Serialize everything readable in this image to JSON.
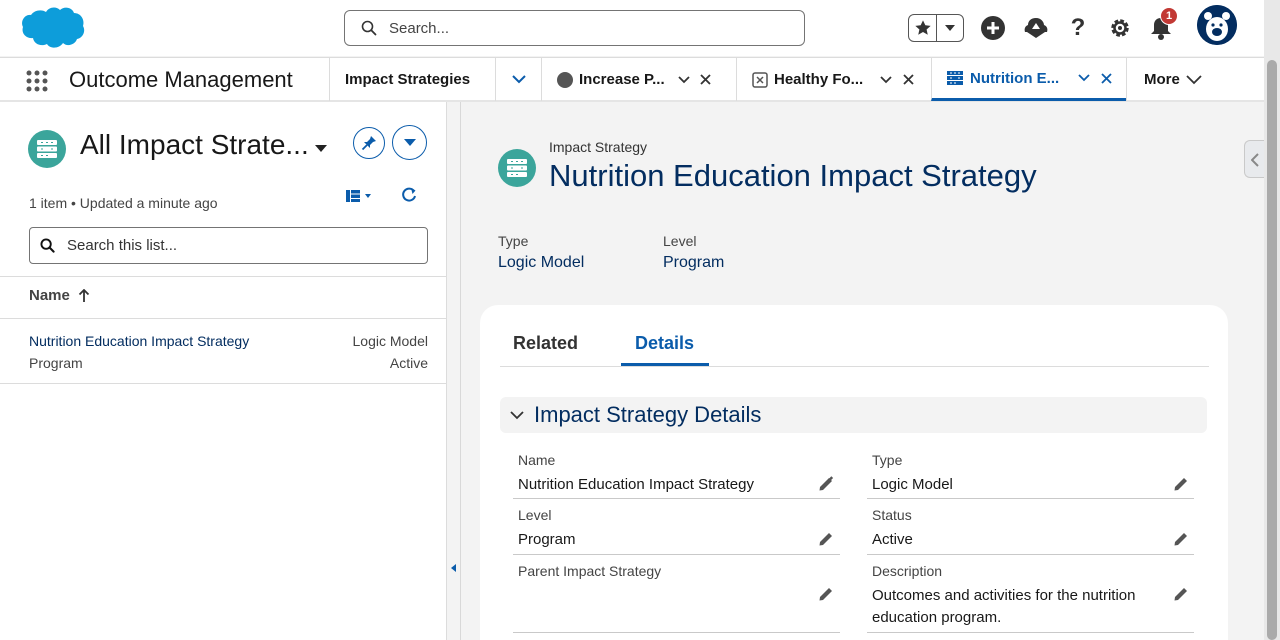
{
  "header": {
    "search_placeholder": "Search...",
    "notification_count": "1"
  },
  "nav": {
    "app_name": "Outcome Management",
    "tabs": [
      {
        "label": "Impact Strategies"
      },
      {
        "label": "Increase P..."
      },
      {
        "label": "Healthy Fo..."
      },
      {
        "label": "Nutrition E..."
      }
    ],
    "more_label": "More"
  },
  "list": {
    "title": "All Impact Strate...",
    "meta": "1 item • Updated a minute ago",
    "search_placeholder": "Search this list...",
    "column_name": "Name",
    "rows": [
      {
        "name": "Nutrition Education Impact Strategy",
        "level": "Program",
        "type": "Logic Model",
        "status": "Active"
      }
    ]
  },
  "record": {
    "object_label": "Impact Strategy",
    "title": "Nutrition Education Impact Strategy",
    "highlights": [
      {
        "label": "Type",
        "value": "Logic Model"
      },
      {
        "label": "Level",
        "value": "Program"
      }
    ],
    "tabs": [
      {
        "label": "Related"
      },
      {
        "label": "Details"
      }
    ],
    "section_title": "Impact Strategy Details",
    "fields": {
      "name": {
        "label": "Name",
        "value": "Nutrition Education Impact Strategy"
      },
      "type": {
        "label": "Type",
        "value": "Logic Model"
      },
      "level": {
        "label": "Level",
        "value": "Program"
      },
      "status": {
        "label": "Status",
        "value": "Active"
      },
      "parent": {
        "label": "Parent Impact Strategy",
        "value": ""
      },
      "description": {
        "label": "Description",
        "value": "Outcomes and activities for the nutrition education program."
      }
    }
  },
  "colors": {
    "brand": "#0b5cab",
    "navy": "#032d60",
    "teal_icon": "#3ba59b",
    "badge_red": "#c23934"
  }
}
